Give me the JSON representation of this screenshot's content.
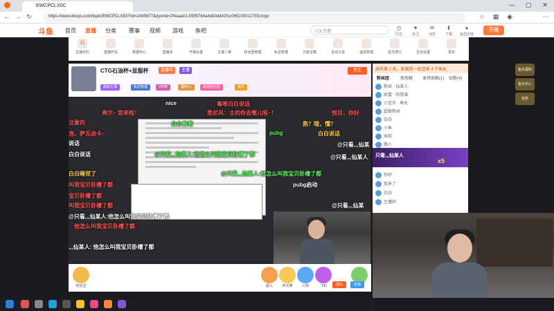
{
  "browser": {
    "tab_title": "EWCPCLX0C",
    "url": "https://www.douyu.com/topic/EWCPCLX83?rid=2445677&dyshid=2f4aaa01-0955784a4dd0dd42f1c06510001175f1#cpp"
  },
  "site": {
    "logo": "斗鱼",
    "nav": [
      {
        "label": "首页",
        "active": false
      },
      {
        "label": "直播",
        "active": true
      },
      {
        "label": "分类",
        "active": false
      },
      {
        "label": "赛事",
        "active": false
      },
      {
        "label": "视频",
        "active": false
      },
      {
        "label": "游戏",
        "active": false
      },
      {
        "label": "鱼吧",
        "active": false
      }
    ],
    "search_placeholder": "LOL专题",
    "header_icons": [
      "历史",
      "关注",
      "消息",
      "下载",
      "鱼翅充值"
    ],
    "open_button": "开播"
  },
  "toolbar": {
    "items": [
      "主播日历",
      "直播开关",
      "数据中心",
      "直播间",
      "开播设置",
      "主播二维",
      "粉丝团管理",
      "私信管理",
      "万能宝箱",
      "互动工具",
      "道具管理",
      "星光排行",
      "互动设置",
      "更多"
    ],
    "date_day": "11"
  },
  "anchor": {
    "room_title": "CTG石油杯+显服杯",
    "badges": [
      "直播中",
      "主播"
    ],
    "follow": "关注",
    "chips": [
      "超级主播",
      "私信管理",
      "VIP榜",
      "福利+1",
      "超级粉丝团",
      "鱼丸"
    ]
  },
  "danmaku": [
    {
      "text": "nice",
      "color": "#ffffff"
    },
    {
      "text": "毒唯白白说话",
      "color": "#ff5a5a"
    },
    {
      "text": "弗尔~ 您来啦！",
      "color": "#ff5a5a"
    },
    {
      "text": "悉尼风：主的你去哪儿啦~！",
      "color": "#ff5a5a"
    },
    {
      "text": "悦目，你好",
      "color": "#ff5a5a"
    },
    {
      "text": "注意的",
      "color": "#ff5a5a"
    },
    {
      "text": "白白餐着",
      "color": "#5cff5c"
    },
    {
      "text": "熬？哦，懂？",
      "color": "#ffd24a"
    },
    {
      "text": "泡，萨瓦迪卡~",
      "color": "#ff5a5a"
    },
    {
      "text": "pubg",
      "color": "#5cff5c"
    },
    {
      "text": "白白说话",
      "color": "#ffd24a"
    },
    {
      "text": "说话",
      "color": "#ffffff"
    },
    {
      "text": "白白说话",
      "color": "#ffffff"
    },
    {
      "text": "@只看,,,仙某人:他怎么叫我宝贝卧槽了都",
      "color": "#5cff5c"
    },
    {
      "text": "@只看,,,仙某",
      "color": "#ffffff"
    },
    {
      "text": "@只看,,,仙某人",
      "color": "#ffffff"
    },
    {
      "text": "白白睡觉了",
      "color": "#ffd24a"
    },
    {
      "text": "@只看,,,仙某人:他怎么叫我宝贝卧槽了都",
      "color": "#5cff5c"
    },
    {
      "text": "叫我宝贝卧槽了都",
      "color": "#ff5a5a"
    },
    {
      "text": "pubg启动",
      "color": "#ffffff"
    },
    {
      "text": "宝贝卧槽了都",
      "color": "#ff5a5a"
    },
    {
      "text": "叫我宝贝卧槽了都",
      "color": "#ff5a5a"
    },
    {
      "text": "@只看,,,仙某",
      "color": "#ffffff"
    },
    {
      "text": "@只看,,,仙某人:他怎么叫我宝贝卧槽了都",
      "color": "#ffffff"
    },
    {
      "text": "他怎么叫我宝贝卧槽了都",
      "color": "#ff5a5a"
    },
    {
      "text": ",,,仙某人: 他怎么叫我宝贝卧槽了都",
      "color": "#ffffff"
    }
  ],
  "gifts": [
    "粉丝宝",
    "超火",
    "荧光棒",
    "火箭",
    "飞机",
    "办卡"
  ],
  "gift_buttons": {
    "send": "送礼",
    "recharge": "充值"
  },
  "rightpanel": {
    "rank_text": "排名第 2 名，距离前一名还差 4 个鱼丸",
    "tabs": [
      {
        "label": "粉丝团",
        "active": true
      },
      {
        "label": "周贡献",
        "active": false
      },
      {
        "label": "本场贡献(1)",
        "active": false
      },
      {
        "label": "钻粉(4)",
        "active": false
      }
    ],
    "rows": [
      "粉丝 · 仙某人",
      "财富 · 你是谁",
      "小宝贝 · 鱼丸",
      "超级粉丝",
      "白白",
      "小鱼",
      "米哈",
      "路人",
      "你好",
      "我来了",
      "白白",
      "主播好"
    ],
    "banner_title": "只看,,,仙某人",
    "banner_x": "x5"
  },
  "side_buttons": [
    "鱼丸福利",
    "鱼丸中心",
    "任务"
  ]
}
